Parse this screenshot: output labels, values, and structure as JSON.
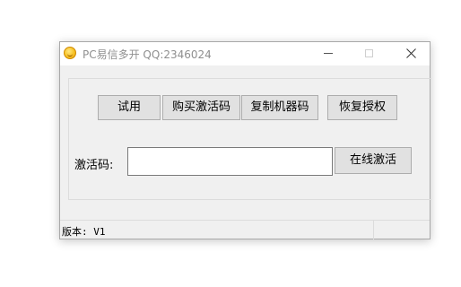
{
  "window": {
    "title": "PC易信多开 QQ:2346024",
    "icon": "smiley-app-icon",
    "controls": {
      "minimize": "minimize-icon",
      "maximize": "maximize-icon",
      "close": "close-icon"
    }
  },
  "toolbar": {
    "trial_label": "试用",
    "buy_code_label": "购买激活码",
    "copy_machine_code_label": "复制机器码",
    "restore_auth_label": "恢复授权"
  },
  "activation": {
    "label": "激活码:",
    "value": "",
    "activate_label": "在线激活"
  },
  "status": {
    "version_text": "版本: V1"
  },
  "colors": {
    "window_bg": "#f0f0f0",
    "titlebar_bg": "#ffffff",
    "button_bg": "#e1e1e1",
    "button_border": "#adadad"
  }
}
